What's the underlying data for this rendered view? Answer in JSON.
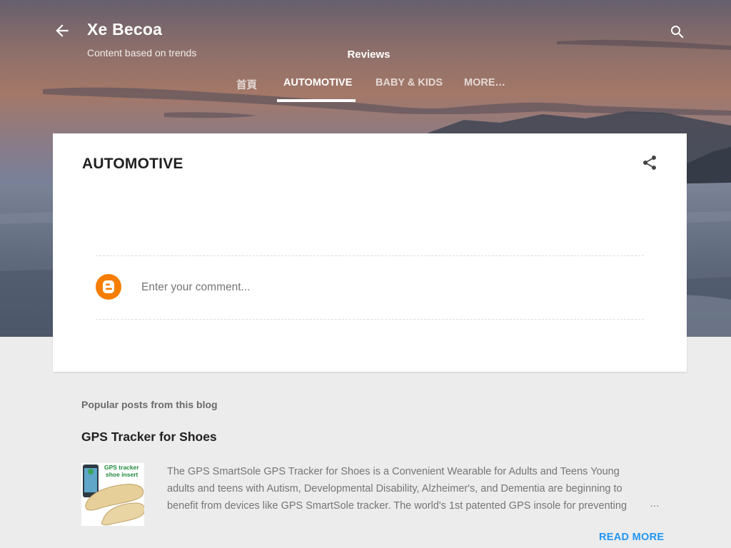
{
  "header": {
    "site_title": "Xe Becoa",
    "site_description": "Content based on trends",
    "section_label": "Reviews",
    "tabs": [
      {
        "label": "首頁",
        "active": false
      },
      {
        "label": "AUTOMOTIVE",
        "active": true
      },
      {
        "label": "BABY & KIDS",
        "active": false
      },
      {
        "label": "MORE…",
        "active": false
      }
    ],
    "icons": {
      "back": "arrow-back-icon",
      "search": "search-icon"
    }
  },
  "post": {
    "title": "AUTOMOTIVE",
    "share_icon": "share-icon",
    "comment": {
      "avatar_icon": "blogger-icon",
      "placeholder": "Enter your comment..."
    }
  },
  "popular": {
    "heading": "Popular posts from this blog",
    "items": [
      {
        "title": "GPS Tracker for Shoes",
        "thumbnail_text": [
          "GPS tracker",
          "shoe insert"
        ],
        "snippet_lines": [
          "The GPS SmartSole GPS Tracker for Shoes  is a Convenient Wearable for Adults and Teens Young",
          "adults and teens with Autism, Developmental Disability, Alzheimer's, and Dementia are beginning to",
          "benefit from devices like GPS SmartSole tracker. The world's 1st patented GPS insole for preventing"
        ],
        "ellipsis": "…",
        "read_more": "READ MORE"
      }
    ]
  },
  "colors": {
    "accent": "#2196f3",
    "blogger_orange": "#f57d00",
    "page_bg": "#ececec"
  }
}
